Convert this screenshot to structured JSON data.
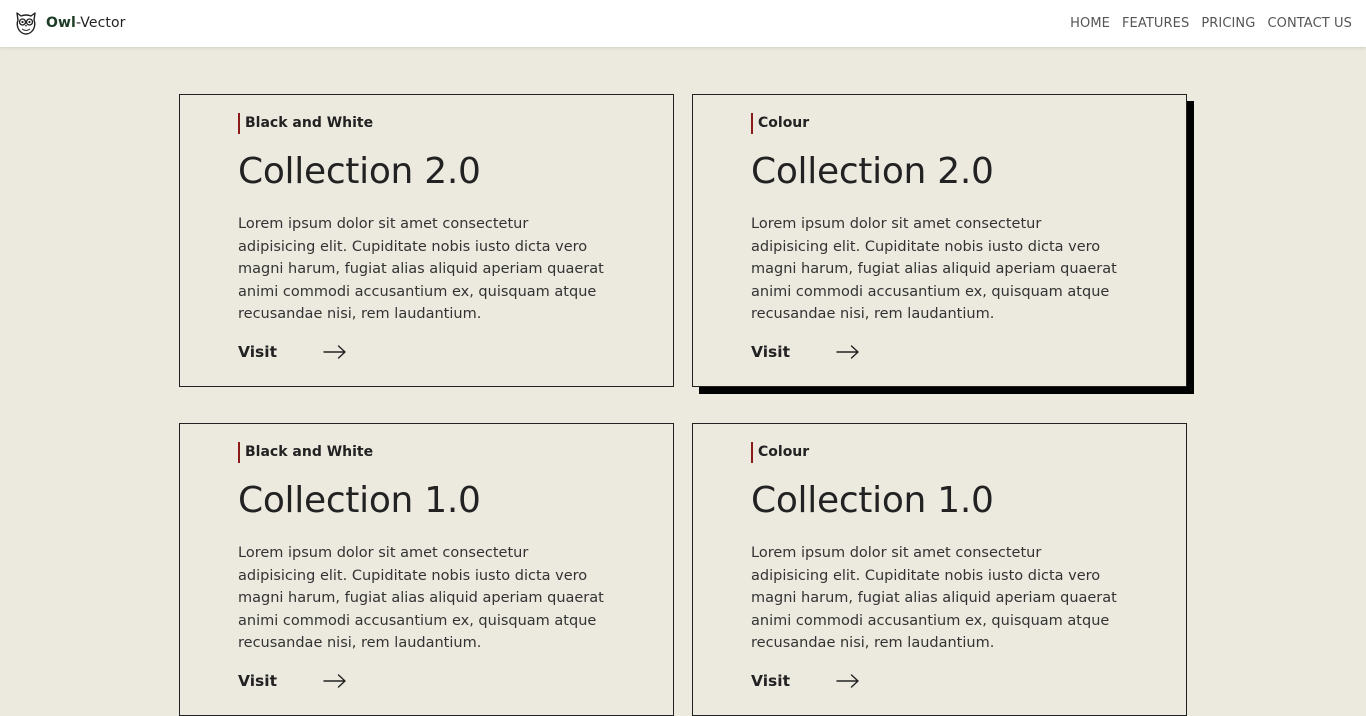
{
  "brand": {
    "strong": "Owl",
    "rest": "-Vector",
    "icon": "owl-icon"
  },
  "nav": {
    "items": [
      {
        "label": "HOME"
      },
      {
        "label": "FEATURES"
      },
      {
        "label": "PRICING"
      },
      {
        "label": "CONTACT US"
      }
    ]
  },
  "colors": {
    "background": "#ece9df",
    "navbar": "#ffffff",
    "accent_bar": "#8b1a1a",
    "text": "#222222",
    "brand_green": "#1d3b26"
  },
  "cards": [
    {
      "tag": "Black and White",
      "title": "Collection 2.0",
      "description": "Lorem ipsum dolor sit amet consectetur adipisicing elit. Cupiditate nobis iusto dicta vero magni harum, fugiat alias aliquid aperiam quaerat animi commodi accusantium ex, quisquam atque recusandae nisi, rem laudantium.",
      "link_label": "Visit",
      "link_icon": "arrow-right-icon"
    },
    {
      "tag": "Colour",
      "title": "Collection 2.0",
      "description": "Lorem ipsum dolor sit amet consectetur adipisicing elit. Cupiditate nobis iusto dicta vero magni harum, fugiat alias aliquid aperiam quaerat animi commodi accusantium ex, quisquam atque recusandae nisi, rem laudantium.",
      "link_label": "Visit",
      "link_icon": "arrow-right-icon"
    },
    {
      "tag": "Black and White",
      "title": "Collection 1.0",
      "description": "Lorem ipsum dolor sit amet consectetur adipisicing elit. Cupiditate nobis iusto dicta vero magni harum, fugiat alias aliquid aperiam quaerat animi commodi accusantium ex, quisquam atque recusandae nisi, rem laudantium.",
      "link_label": "Visit",
      "link_icon": "arrow-right-icon"
    },
    {
      "tag": "Colour",
      "title": "Collection 1.0",
      "description": "Lorem ipsum dolor sit amet consectetur adipisicing elit. Cupiditate nobis iusto dicta vero magni harum, fugiat alias aliquid aperiam quaerat animi commodi accusantium ex, quisquam atque recusandae nisi, rem laudantium.",
      "link_label": "Visit",
      "link_icon": "arrow-right-icon"
    }
  ]
}
